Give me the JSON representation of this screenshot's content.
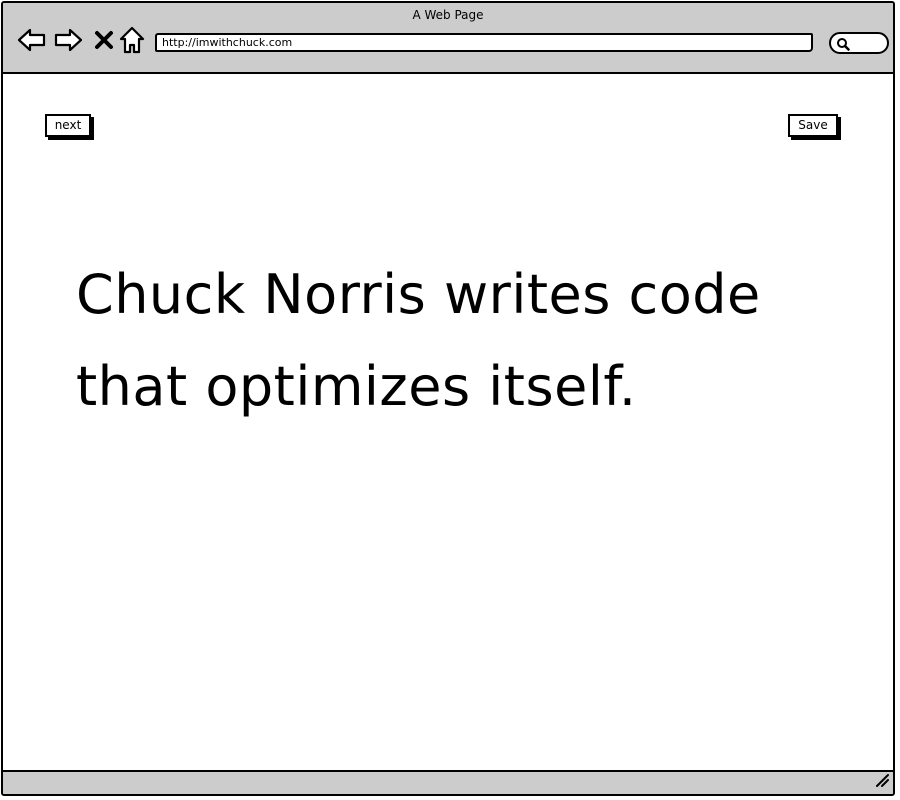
{
  "window": {
    "title": "A Web Page"
  },
  "toolbar": {
    "url": "http://imwithchuck.com",
    "icons": [
      "back-arrow-icon",
      "forward-arrow-icon",
      "close-icon",
      "home-icon",
      "search-icon"
    ]
  },
  "page": {
    "next_label": "next",
    "save_label": "Save",
    "quote": "Chuck Norris writes code that optimizes itself."
  },
  "statusbar": {
    "icons": [
      "resize-grip-icon"
    ]
  },
  "colors": {
    "chrome": "#cccccc",
    "background": "#ffffff",
    "ink": "#000000"
  }
}
